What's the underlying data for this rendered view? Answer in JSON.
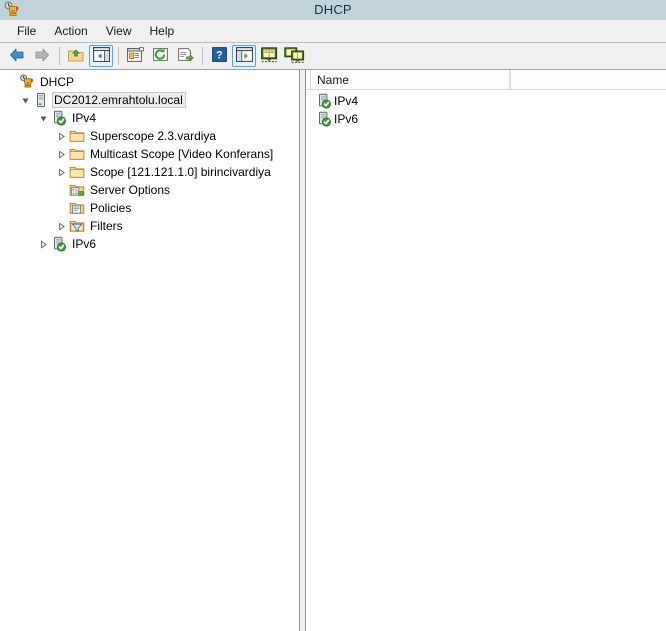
{
  "window": {
    "title": "DHCP",
    "app_icon": "dhcp-server-icon"
  },
  "menubar": {
    "items": [
      {
        "label": "File",
        "name": "menu-file"
      },
      {
        "label": "Action",
        "name": "menu-action"
      },
      {
        "label": "View",
        "name": "menu-view"
      },
      {
        "label": "Help",
        "name": "menu-help"
      }
    ]
  },
  "toolbar": {
    "buttons": [
      {
        "name": "back-button",
        "icon": "arrow-left-icon",
        "active": false
      },
      {
        "name": "forward-button",
        "icon": "arrow-right-icon",
        "active": false
      },
      {
        "name": "up-one-level-button",
        "icon": "folder-up-icon",
        "active": false
      },
      {
        "name": "show-hide-console-tree-button",
        "icon": "console-tree-icon",
        "active": true
      },
      {
        "name": "properties-button",
        "icon": "properties-icon",
        "active": false
      },
      {
        "name": "refresh-button",
        "icon": "refresh-icon",
        "active": false
      },
      {
        "name": "export-list-button",
        "icon": "export-list-icon",
        "active": false
      },
      {
        "name": "help-button",
        "icon": "question-mark-icon",
        "active": false
      },
      {
        "name": "show-hide-action-pane-button",
        "icon": "action-pane-icon",
        "active": true
      },
      {
        "name": "add-server-button",
        "icon": "monitor-book-icon",
        "active": false
      },
      {
        "name": "manage-servers-button",
        "icon": "two-monitors-icon",
        "active": false
      }
    ]
  },
  "tree": {
    "nodes": [
      {
        "label": "DHCP",
        "name": "tree-item-dhcp",
        "indent": 0,
        "expander": "none",
        "icon": "dhcp-root-icon",
        "selected": false
      },
      {
        "label": "DC2012.emrahtolu.local",
        "name": "tree-item-dc2012-emrahtolu-local",
        "indent": 1,
        "expander": "expanded",
        "icon": "server-icon",
        "selected": true
      },
      {
        "label": "IPv4",
        "name": "tree-item-ipv4",
        "indent": 2,
        "expander": "expanded",
        "icon": "server-ok-icon",
        "selected": false
      },
      {
        "label": "Superscope 2.3.vardiya",
        "name": "tree-item-superscope-2-3-vardiya",
        "indent": 3,
        "expander": "collapsed",
        "icon": "folder-icon",
        "selected": false
      },
      {
        "label": "Multicast Scope [Video Konferans]",
        "name": "tree-item-multicast-scope-video-konferans",
        "indent": 3,
        "expander": "collapsed",
        "icon": "folder-icon",
        "selected": false
      },
      {
        "label": "Scope [121.121.1.0] birincivardiya",
        "name": "tree-item-scope-121-121-1-0-birincivardiya",
        "indent": 3,
        "expander": "collapsed",
        "icon": "folder-icon",
        "selected": false
      },
      {
        "label": "Server Options",
        "name": "tree-item-server-options",
        "indent": 3,
        "expander": "none",
        "icon": "server-options-icon",
        "selected": false
      },
      {
        "label": "Policies",
        "name": "tree-item-policies",
        "indent": 3,
        "expander": "none",
        "icon": "policies-icon",
        "selected": false
      },
      {
        "label": "Filters",
        "name": "tree-item-filters",
        "indent": 3,
        "expander": "collapsed",
        "icon": "filter-icon",
        "selected": false
      },
      {
        "label": "IPv6",
        "name": "tree-item-ipv6",
        "indent": 2,
        "expander": "collapsed",
        "icon": "server-ok-icon",
        "selected": false
      }
    ]
  },
  "list": {
    "columns": [
      {
        "label": "Name",
        "name": "column-header-name"
      }
    ],
    "rows": [
      {
        "label": "IPv4",
        "name": "list-item-ipv4",
        "icon": "server-ok-icon"
      },
      {
        "label": "IPv6",
        "name": "list-item-ipv6",
        "icon": "server-ok-icon"
      }
    ]
  },
  "colors": {
    "titlebar": "#bfd3d9",
    "chrome": "#f0f0f0",
    "accent_active_border": "#4aa8d8",
    "status_ok_green": "#3f9e35",
    "folder_yellow": "#f5cd73"
  }
}
